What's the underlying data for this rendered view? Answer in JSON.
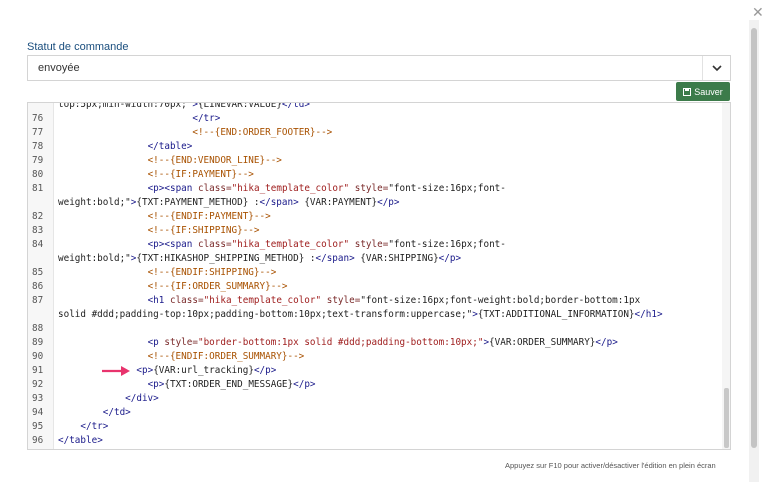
{
  "status": {
    "label": "Statut de commande",
    "value": "envoyée"
  },
  "save_label": "Sauver",
  "hint": "Appuyez sur F10 pour activer/désactiver l'édition en plein écran",
  "code_lines": [
    {
      "n": "",
      "text": "top:5px;min-width:70px;\">{LINEVAR:VALUE}</td>"
    },
    {
      "n": "76",
      "text": "                        </tr>"
    },
    {
      "n": "77",
      "text": "                        <!--{END:ORDER_FOOTER}-->"
    },
    {
      "n": "78",
      "text": "                </table>"
    },
    {
      "n": "79",
      "text": "                <!--{END:VENDOR_LINE}-->"
    },
    {
      "n": "80",
      "text": "                <!--{IF:PAYMENT}-->"
    },
    {
      "n": "81",
      "text": "                <p><span class=\"hika_template_color\" style=\"font-size:16px;font-"
    },
    {
      "n": "",
      "text": "weight:bold;\">{TXT:PAYMENT_METHOD} :</span> {VAR:PAYMENT}</p>"
    },
    {
      "n": "82",
      "text": "                <!--{ENDIF:PAYMENT}-->"
    },
    {
      "n": "83",
      "text": "                <!--{IF:SHIPPING}-->"
    },
    {
      "n": "84",
      "text": "                <p><span class=\"hika_template_color\" style=\"font-size:16px;font-"
    },
    {
      "n": "",
      "text": "weight:bold;\">{TXT:HIKASHOP_SHIPPING_METHOD} :</span> {VAR:SHIPPING}</p>"
    },
    {
      "n": "85",
      "text": "                <!--{ENDIF:SHIPPING}-->"
    },
    {
      "n": "86",
      "text": "                <!--{IF:ORDER_SUMMARY}-->"
    },
    {
      "n": "87",
      "text": "                <h1 class=\"hika_template_color\" style=\"font-size:16px;font-weight:bold;border-bottom:1px"
    },
    {
      "n": "",
      "text": "solid #ddd;padding-top:10px;padding-bottom:10px;text-transform:uppercase;\">{TXT:ADDITIONAL_INFORMATION}</h1>"
    },
    {
      "n": "88",
      "text": ""
    },
    {
      "n": "89",
      "text": "                <p style=\"border-bottom:1px solid #ddd;padding-bottom:10px;\">{VAR:ORDER_SUMMARY}</p>"
    },
    {
      "n": "90",
      "text": "                <!--{ENDIF:ORDER_SUMMARY}-->"
    },
    {
      "n": "91",
      "text": "              <p>{VAR:url_tracking}</p>"
    },
    {
      "n": "92",
      "text": "                <p>{TXT:ORDER_END_MESSAGE}</p>"
    },
    {
      "n": "93",
      "text": "            </div>"
    },
    {
      "n": "94",
      "text": "        </td>"
    },
    {
      "n": "95",
      "text": "    </tr>"
    },
    {
      "n": "96",
      "text": "</table>"
    }
  ],
  "colors": {
    "save_button": "#3c7b4a",
    "arrow": "#e8336d",
    "label": "#1a4e7e"
  },
  "icons": {
    "close": "close-icon",
    "chevron": "chevron-down-icon",
    "save": "save-icon",
    "arrow": "arrow-right-icon"
  }
}
